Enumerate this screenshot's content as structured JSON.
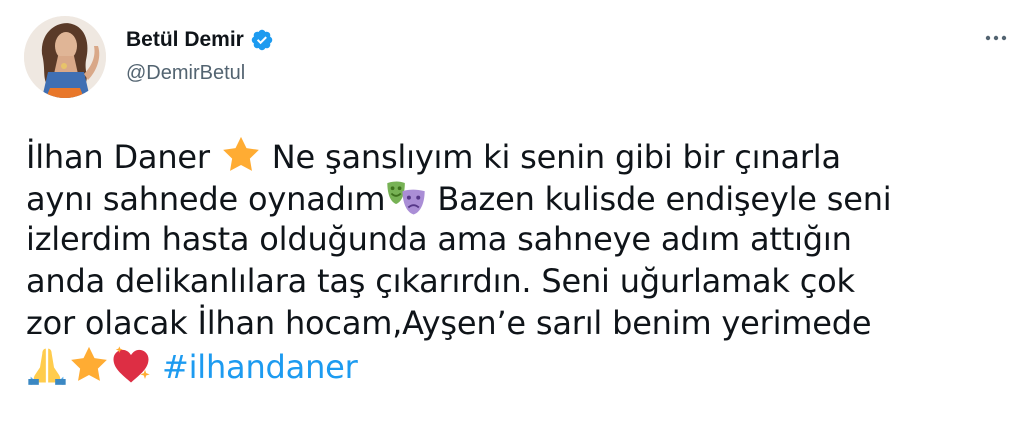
{
  "author": {
    "display_name": "Betül Demir",
    "handle": "@DemirBetul",
    "verified": true,
    "avatar_icon": "profile-photo",
    "verified_icon": "verified-badge-icon"
  },
  "more_options_icon": "more-horizontal-icon",
  "tweet": {
    "line1_a": "İlhan Daner ",
    "emoji_star_1": "star-emoji",
    "line1_b": " Ne şanslıyım ki senin gibi bir çınarla",
    "line2_a": "aynı sahnede oynadım",
    "emoji_masks": "performing-arts-emoji",
    "line2_b": " Bazen kulisde endişeyle seni",
    "line3": "izlerdim hasta olduğunda ama sahneye adım attığın",
    "line4": "anda delikanlılara taş çıkarırdın. Seni uğurlamak çok",
    "line5": "zor olacak İlhan hocam,Ayşen’e sarıl benim yerimede",
    "emoji_pray": "folded-hands-emoji",
    "emoji_star_2": "star-emoji",
    "emoji_heart": "sparkling-heart-emoji",
    "hashtag": "#ilhandaner"
  },
  "colors": {
    "text": "#0f1419",
    "secondary": "#536471",
    "link": "#1d9bf0",
    "verified": "#1d9bf0"
  }
}
